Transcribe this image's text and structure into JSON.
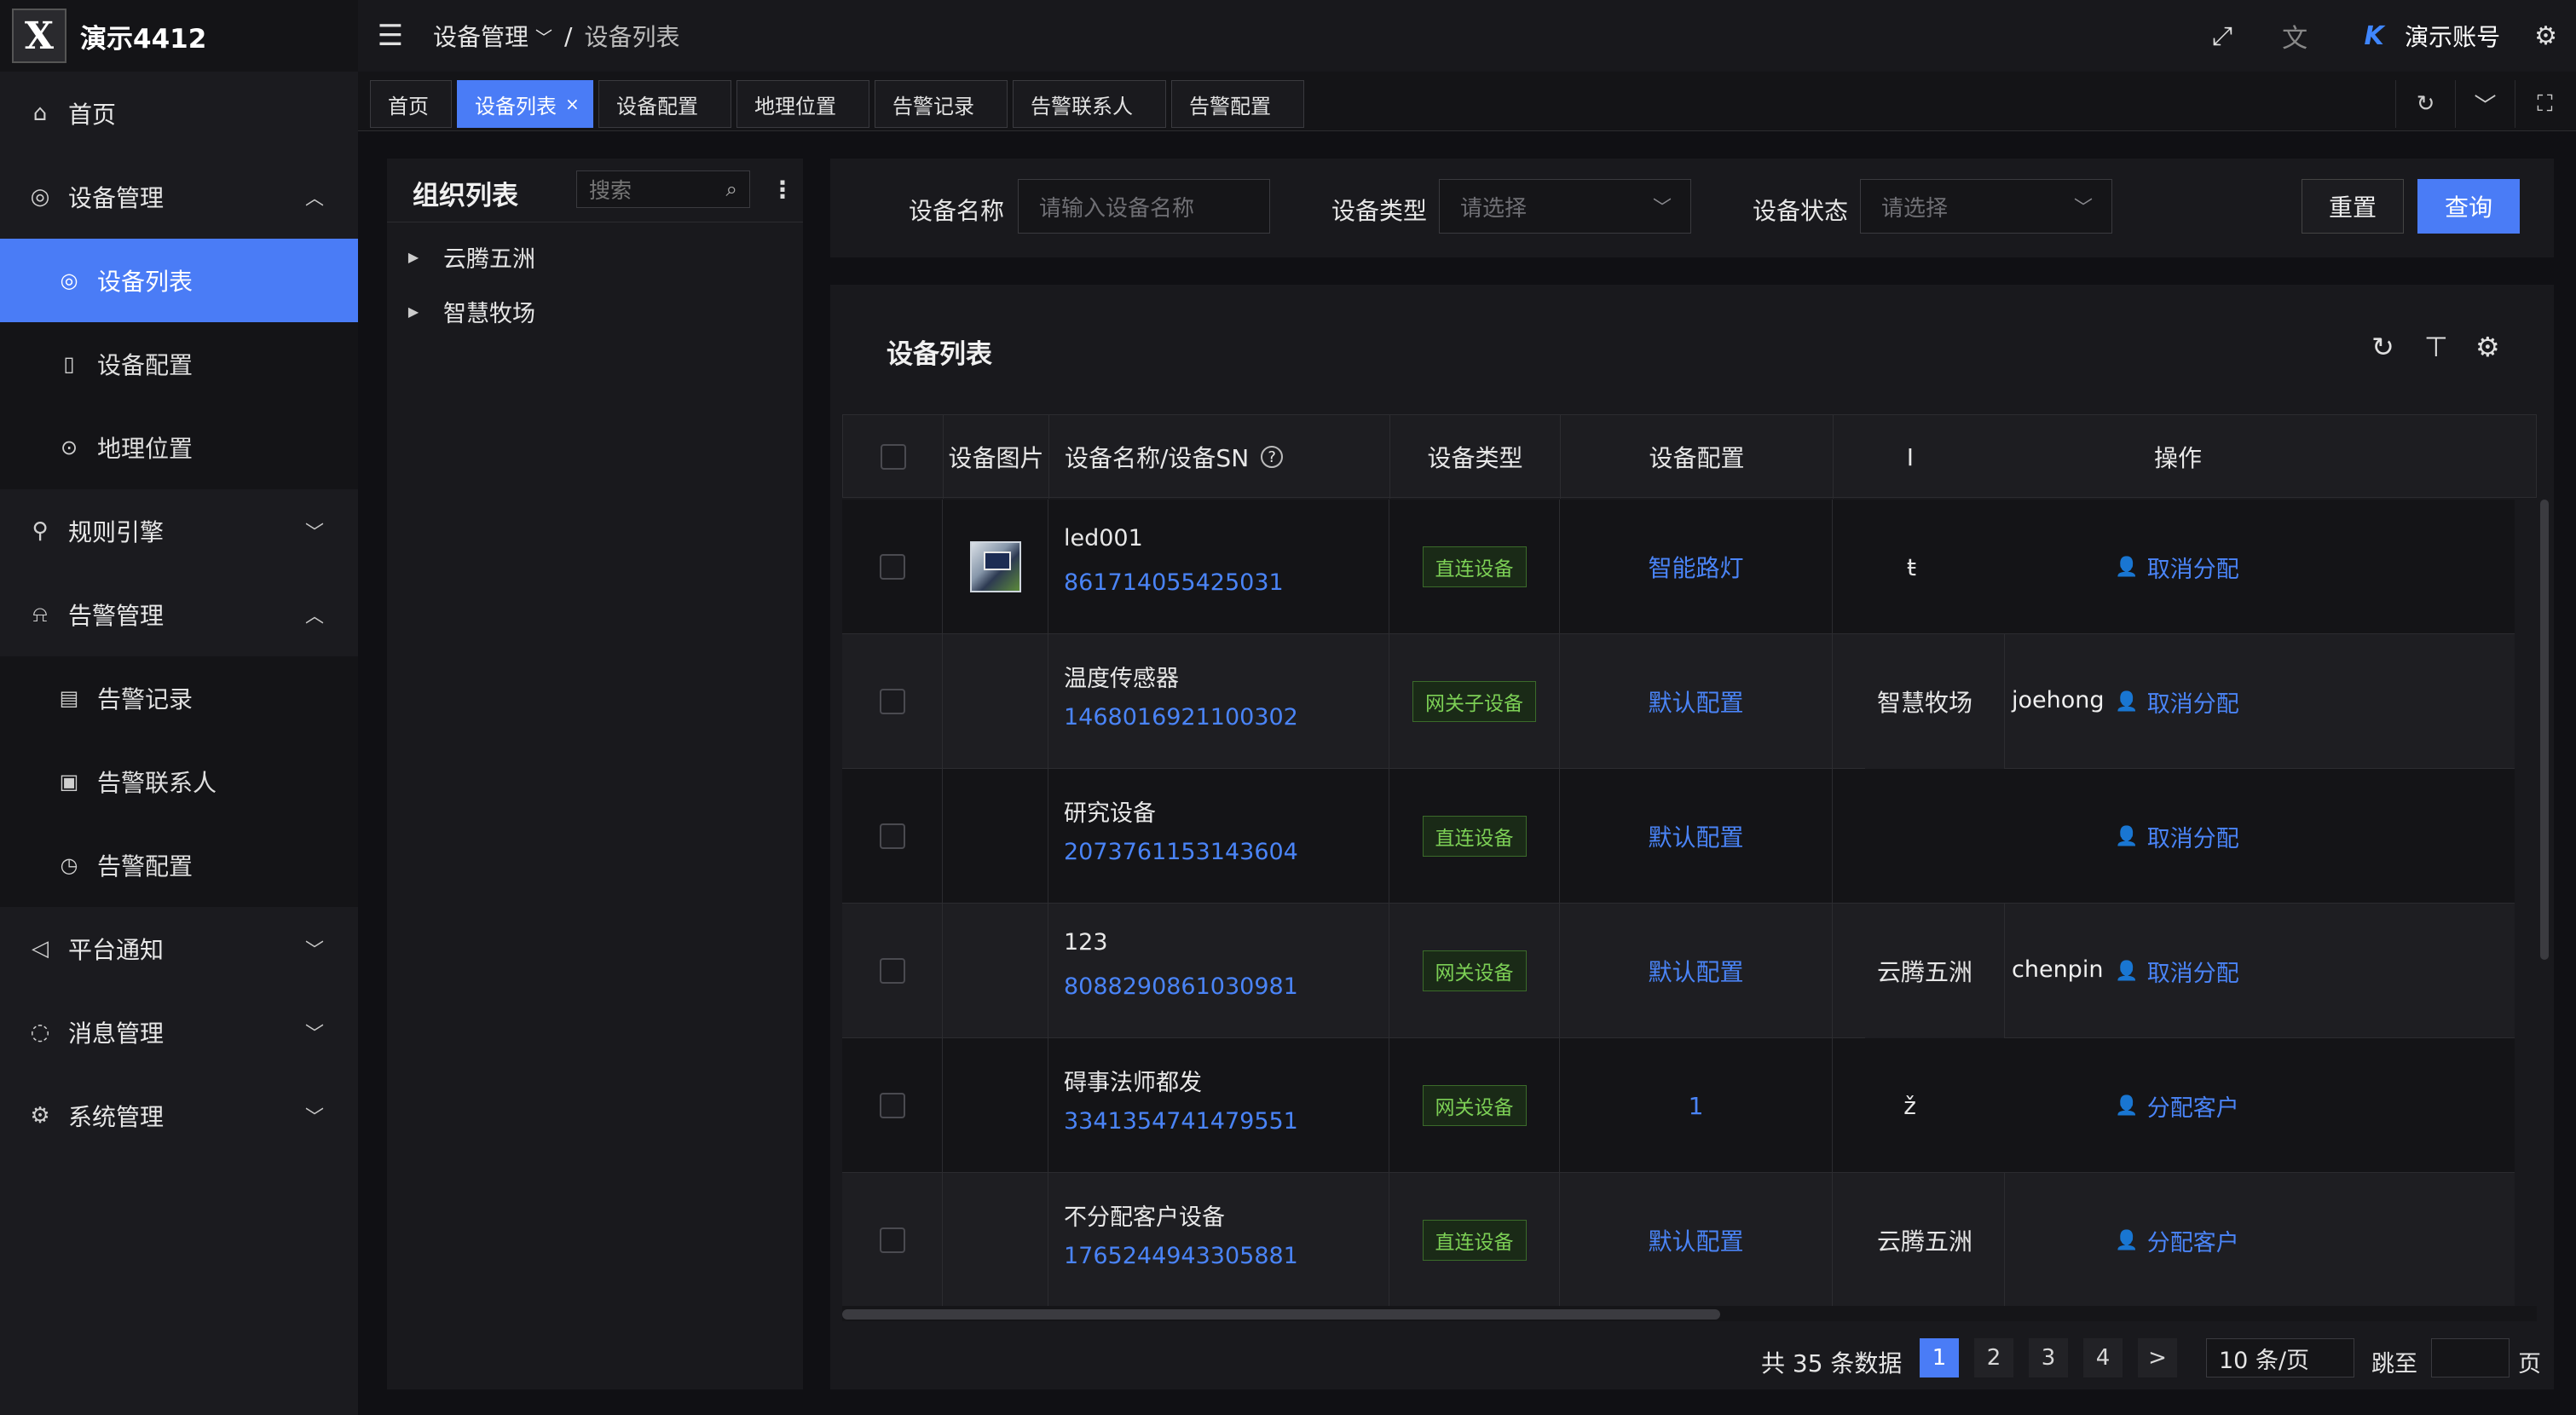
{
  "app": {
    "title": "演示4412",
    "logo_letter": "X"
  },
  "sidebar": {
    "home": "首页",
    "device_mgmt": "设备管理",
    "device_list": "设备列表",
    "device_config": "设备配置",
    "geo_location": "地理位置",
    "rule_engine": "规则引擎",
    "alarm_mgmt": "告警管理",
    "alarm_records": "告警记录",
    "alarm_contacts": "告警联系人",
    "alarm_config": "告警配置",
    "platform_notice": "平台通知",
    "message_mgmt": "消息管理",
    "system_mgmt": "系统管理"
  },
  "header": {
    "breadcrumb_1": "设备管理",
    "breadcrumb_sep": "/",
    "breadcrumb_2": "设备列表",
    "avatar_letter": "K",
    "account": "演示账号"
  },
  "tabs": [
    "首页",
    "设备列表",
    "设备配置",
    "地理位置",
    "告警记录",
    "告警联系人",
    "告警配置"
  ],
  "org_panel": {
    "title": "组织列表",
    "search_placeholder": "搜索",
    "nodes": [
      "云腾五洲",
      "智慧牧场"
    ]
  },
  "filter": {
    "name_label": "设备名称",
    "name_placeholder": "请输入设备名称",
    "type_label": "设备类型",
    "type_placeholder": "请选择",
    "status_label": "设备状态",
    "status_placeholder": "请选择",
    "reset": "重置",
    "query": "查询"
  },
  "table": {
    "title": "设备列表",
    "columns": {
      "image": "设备图片",
      "name_sn": "设备名称/设备SN",
      "type": "设备类型",
      "config": "设备配置",
      "org_partial": "I",
      "ops": "操作"
    },
    "rows": [
      {
        "name": "led001",
        "sn": "861714055425031",
        "type": "直连设备",
        "config": "智能路灯",
        "org": "",
        "org_stub": "ŧ",
        "op": "取消分配",
        "overlap": "",
        "has_image": true
      },
      {
        "name": "温度传感器",
        "sn": "1468016921100302",
        "type": "网关子设备",
        "config": "默认配置",
        "org": "智慧牧场",
        "org_stub": "",
        "op": "取消分配",
        "overlap": "joehong",
        "has_image": false
      },
      {
        "name": "研究设备",
        "sn": "2073761153143604",
        "type": "直连设备",
        "config": "默认配置",
        "org": "",
        "org_stub": "",
        "op": "取消分配",
        "overlap": "",
        "has_image": false
      },
      {
        "name": "123",
        "sn": "8088290861030981",
        "type": "网关设备",
        "config": "默认配置",
        "org": "云腾五洲",
        "org_stub": "",
        "op": "取消分配",
        "overlap": "chenpin",
        "has_image": false
      },
      {
        "name": "碍事法师都发",
        "sn": "3341354741479551",
        "type": "网关设备",
        "config": "1",
        "org": "",
        "org_stub": "ž",
        "op": "分配客户",
        "overlap": "",
        "has_image": false
      },
      {
        "name": "不分配客户设备",
        "sn": "1765244943305881",
        "type": "直连设备",
        "config": "默认配置",
        "org": "云腾五洲",
        "org_stub": "",
        "op": "分配客户",
        "overlap": "",
        "has_image": false
      }
    ]
  },
  "pagination": {
    "total": "共 35 条数据",
    "pages": [
      "1",
      "2",
      "3",
      "4"
    ],
    "current": "1",
    "next": ">",
    "page_size": "10 条/页",
    "jump_label": "跳至",
    "jump_unit": "页"
  }
}
